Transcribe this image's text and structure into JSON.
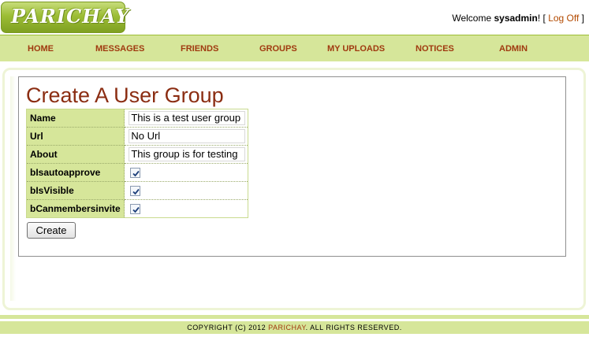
{
  "header": {
    "logo_text": "PARICHAY",
    "welcome_prefix": "Welcome ",
    "username": "sysadmin",
    "welcome_suffix": "! [ ",
    "logoff_label": "Log Off",
    "bracket_close": " ]"
  },
  "nav": {
    "items": [
      {
        "label": "HOME"
      },
      {
        "label": "MESSAGES"
      },
      {
        "label": "FRIENDS"
      },
      {
        "label": "GROUPS"
      },
      {
        "label": "MY UPLOADS"
      },
      {
        "label": "NOTICES"
      },
      {
        "label": "ADMIN"
      }
    ]
  },
  "page": {
    "title": "Create A User Group"
  },
  "form": {
    "name_label": "Name",
    "name_value": "This is a test user group",
    "url_label": "Url",
    "url_value": "No Url",
    "about_label": "About",
    "about_value": "This group is for testing",
    "autoapprove_label": "bIsautoapprove",
    "autoapprove_checked": true,
    "visible_label": "bIsVisible",
    "visible_checked": true,
    "caninvite_label": "bCanmembersinvite",
    "caninvite_checked": true,
    "create_label": "Create"
  },
  "footer": {
    "prefix": "COPYRIGHT (C) 2012 ",
    "brand": "PARICHAY",
    "suffix": ". ALL RIGHTS RESERVED."
  },
  "colors": {
    "nav_bg": "#d6e69a",
    "nav_text": "#a03a10",
    "title": "#8b2d12",
    "logo_green": "#9cbd35"
  }
}
